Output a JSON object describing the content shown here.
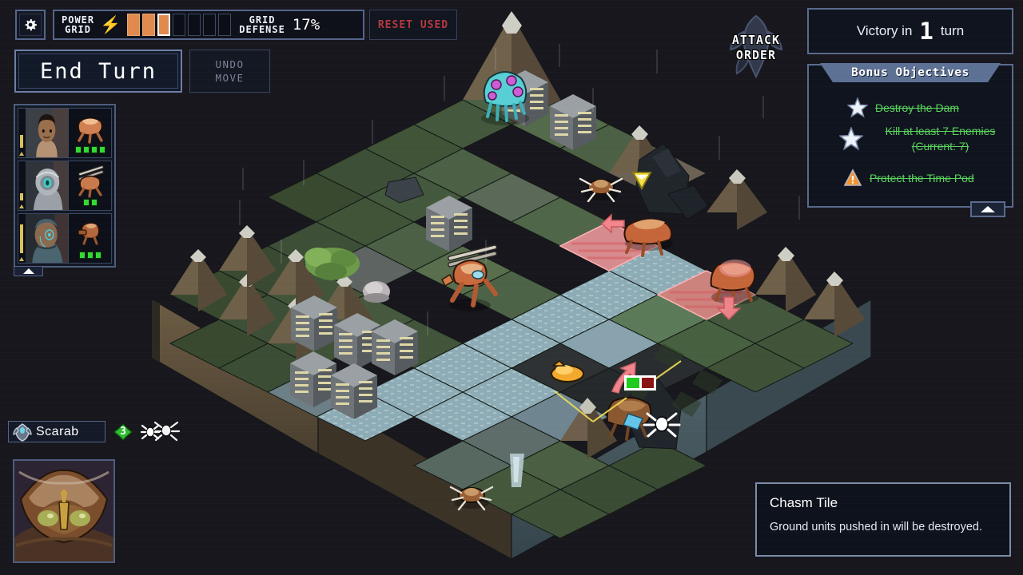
{
  "hud": {
    "settings_icon": "gear-icon",
    "power_grid_label": "POWER\nGRID",
    "power_bolt_icon": "lightning-bolt-icon",
    "power_cells_total": 7,
    "power_cells_filled": 3,
    "power_cell_current_index": 3,
    "grid_defense_label": "GRID\nDEFENSE",
    "grid_defense_value": "17%",
    "reset_used_label": "RESET USED",
    "end_turn_label": "End Turn",
    "undo_move_label": "UNDO\nMOVE",
    "roster_collapse_icon": "chevron-up-icon"
  },
  "colors": {
    "accent_blue": "#5a6a8d",
    "power_orange": "#e08a4e",
    "reset_red": "#b6383f",
    "objective_green": "#59d45c",
    "health_green": "#35d935",
    "attack_pink": "#f2868c",
    "background": "#17171d"
  },
  "roster": {
    "mechs": [
      {
        "pilot_icon": "pilot-portrait-1",
        "mech_icon": "mech-sprite-combat",
        "health": 4,
        "max_health": 4,
        "xp_fill_pct": 35
      },
      {
        "pilot_icon": "pilot-portrait-2",
        "mech_icon": "mech-sprite-artillery",
        "health": 2,
        "max_health": 2,
        "xp_fill_pct": 18
      },
      {
        "pilot_icon": "pilot-portrait-3",
        "mech_icon": "mech-sprite-cannon",
        "health": 3,
        "max_health": 3,
        "xp_fill_pct": 70
      }
    ]
  },
  "selected_enemy": {
    "name": "Scarab",
    "unit_icon": "scarab-unit-icon",
    "health": "3",
    "health_badge_icon": "health-badge-icon",
    "enemy_type_icon": "spider-icon",
    "portrait_icon": "scarab-portrait"
  },
  "attack_order": {
    "label": "ATTACK\nORDER",
    "line1": "ATTACK",
    "line2": "ORDER",
    "icon": "vek-silhouette-icon"
  },
  "victory": {
    "prefix": "Victory in",
    "turns": "1",
    "suffix": "turn"
  },
  "objectives": {
    "title": "Bonus Objectives",
    "items": [
      {
        "icon": "star-icon",
        "text": "Destroy the Dam",
        "text2": "",
        "completed": true
      },
      {
        "icon": "star-icon",
        "text": "Kill at least 7 Enemies",
        "text2": "(Current: 7)",
        "completed": true
      },
      {
        "icon": "warning-icon",
        "text": "Protect the Time Pod",
        "text2": "",
        "completed": true
      }
    ],
    "collapse_icon": "chevron-up-icon"
  },
  "tooltip": {
    "title": "Chasm Tile",
    "body": "Ground units pushed in will be destroyed."
  },
  "board": {
    "units": [
      {
        "name": "blobber",
        "icon": "cyan-blobber-unit",
        "side": "enemy"
      },
      {
        "name": "spider-1",
        "icon": "spider-unit",
        "side": "enemy"
      },
      {
        "name": "spider-2",
        "icon": "spider-unit",
        "side": "enemy"
      },
      {
        "name": "spider-3",
        "icon": "spider-unit",
        "side": "enemy"
      },
      {
        "name": "scarab-1",
        "icon": "scarab-unit",
        "side": "enemy",
        "attacking": true
      },
      {
        "name": "scarab-2",
        "icon": "scarab-unit",
        "side": "enemy",
        "attacking": true
      },
      {
        "name": "scarab-3",
        "icon": "scarab-unit",
        "side": "enemy",
        "health_bar": "1/2"
      },
      {
        "name": "mech-combat",
        "icon": "mech-unit",
        "side": "player"
      }
    ],
    "markers": [
      {
        "name": "shield-marker",
        "icon": "yellow-shield-icon"
      },
      {
        "name": "time-pod",
        "icon": "orange-pod-icon"
      },
      {
        "name": "push-arrow-1",
        "icon": "pink-arrow-icon"
      },
      {
        "name": "push-arrow-2",
        "icon": "pink-arrow-icon"
      },
      {
        "name": "push-arrow-3",
        "icon": "pink-arrow-icon"
      },
      {
        "name": "enemy-health-bar",
        "icon": "health-bar",
        "green": 1,
        "red": 1
      },
      {
        "name": "target-spider-icon",
        "icon": "spider-icon"
      }
    ]
  }
}
